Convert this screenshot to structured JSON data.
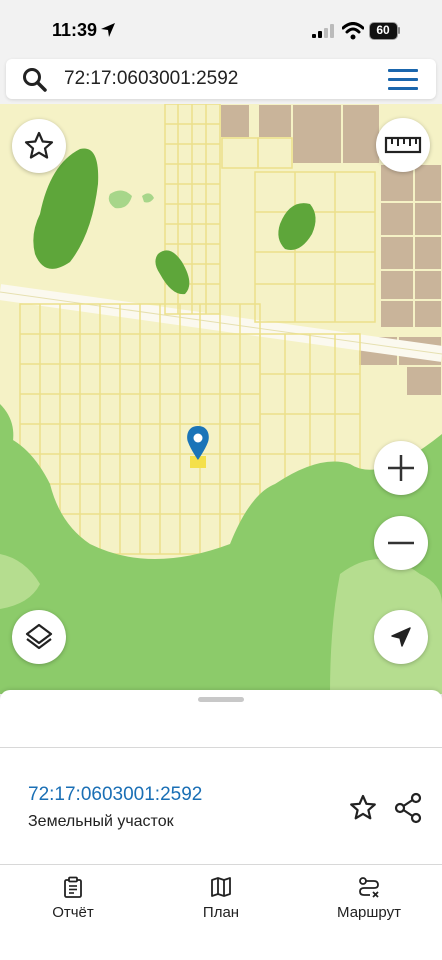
{
  "status_bar": {
    "time": "11:39",
    "battery": "60"
  },
  "search": {
    "value": "72:17:0603001:2592"
  },
  "map": {
    "buttons": [
      "favorite",
      "ruler",
      "zoom-in",
      "zoom-out",
      "layers",
      "location"
    ],
    "marker_icon": "map-pin-icon"
  },
  "parcel": {
    "cadastral_number": "72:17:0603001:2592",
    "type": "Земельный участок"
  },
  "tabs": [
    {
      "label": "Отчёт",
      "icon": "report-icon"
    },
    {
      "label": "План",
      "icon": "map-plan-icon"
    },
    {
      "label": "Маршрут",
      "icon": "route-icon"
    }
  ],
  "colors": {
    "accent": "#1a66ad",
    "map_base": "#f4f1c4",
    "forest": "#8ccb6a",
    "buildings": "#c9b49a",
    "parcel_lines": "#ece08a"
  }
}
